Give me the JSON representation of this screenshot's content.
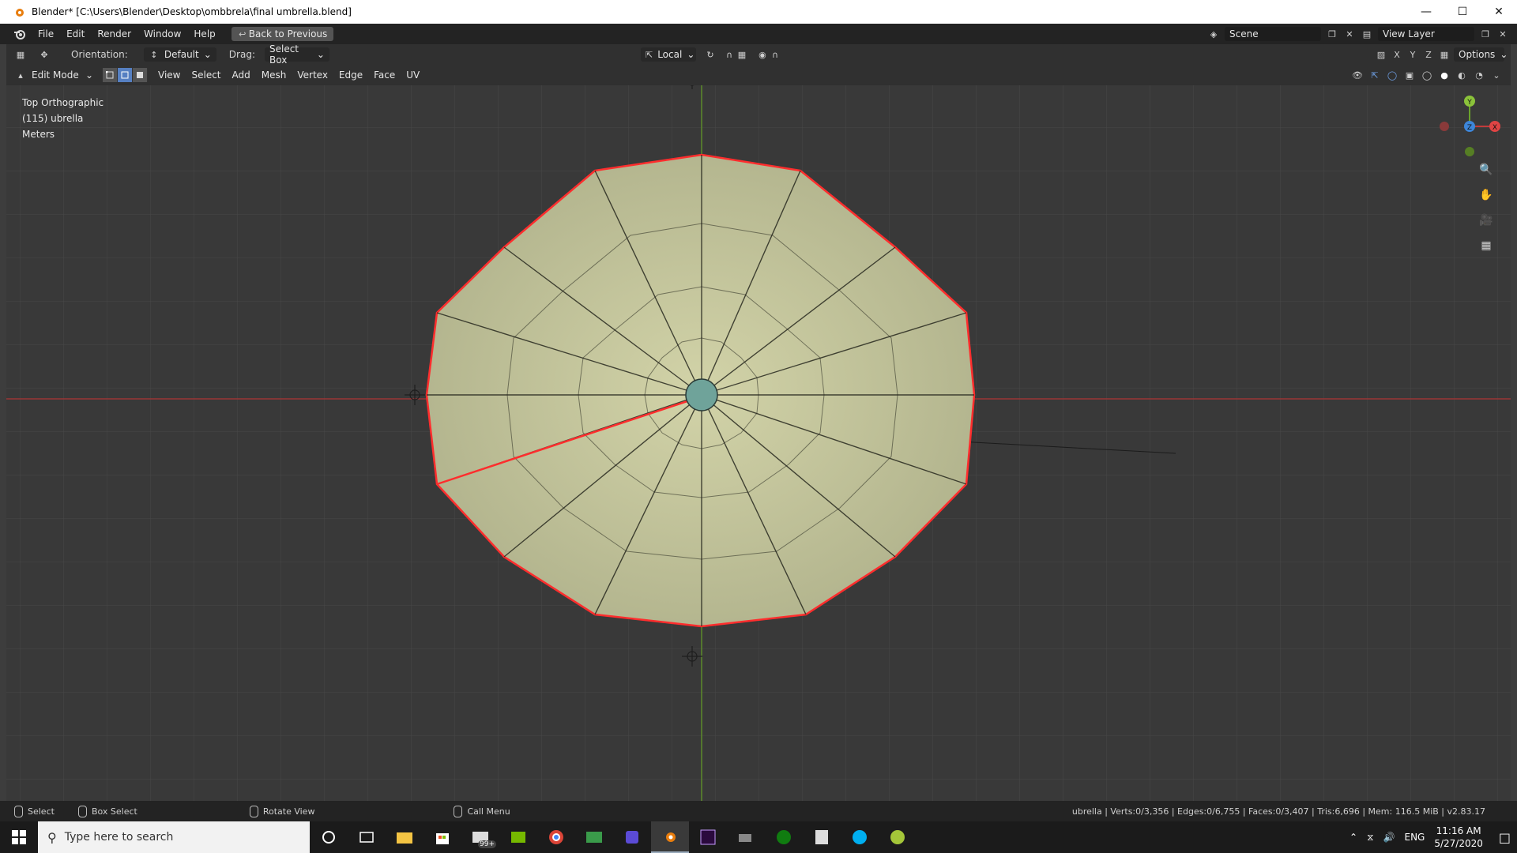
{
  "window": {
    "title": "Blender* [C:\\Users\\Blender\\Desktop\\ombbrela\\final umbrella.blend]",
    "controls": [
      "minimize-icon",
      "maximize-icon",
      "close-icon"
    ]
  },
  "topbar": {
    "menus": [
      "File",
      "Edit",
      "Render",
      "Window",
      "Help"
    ],
    "back_button": "Back to Previous",
    "scene": "Scene",
    "view_layer": "View Layer"
  },
  "toolheader": {
    "orientation_label": "Orientation:",
    "orientation_value": "Default",
    "drag_label": "Drag:",
    "drag_value": "Select Box",
    "pivot_value": "Local",
    "axes": [
      "X",
      "Y",
      "Z"
    ],
    "options": "Options"
  },
  "header3d": {
    "mode": "Edit Mode",
    "menus": [
      "View",
      "Select",
      "Add",
      "Mesh",
      "Vertex",
      "Edge",
      "Face",
      "UV"
    ]
  },
  "viewport": {
    "view_name": "Top Orthographic",
    "object": "(115) ubrella",
    "units": "Meters",
    "gizmo": {
      "x": "X",
      "y": "Y",
      "z": "Z"
    },
    "colors": {
      "mesh_fill": "#c3c497",
      "x_axis": "#c23b3b",
      "y_axis": "#6aa32c",
      "selection": "#ff2d2d",
      "z_axis": "#3d86d9"
    }
  },
  "statusbar": {
    "select": "Select",
    "box_select": "Box Select",
    "rotate_view": "Rotate View",
    "call_menu": "Call Menu",
    "stats": "ubrella | Verts:0/3,356 | Edges:0/6,755 | Faces:0/3,407 | Tris:6,696 | Mem: 116.5 MiB | v2.83.17"
  },
  "taskbar": {
    "search_placeholder": "Type here to search",
    "mail_badge": "99+",
    "language": "ENG",
    "time": "11:16 AM",
    "date": "5/27/2020"
  }
}
